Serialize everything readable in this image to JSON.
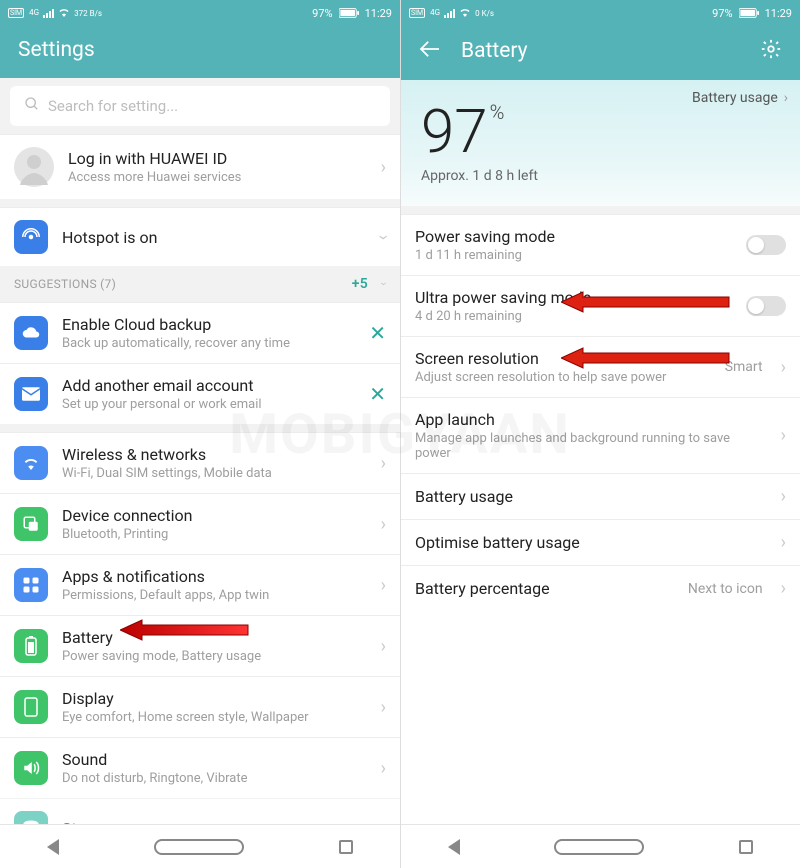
{
  "status": {
    "net1": "372 B/s",
    "net2": "0 K/s",
    "battery": "97%",
    "time": "11:29"
  },
  "left": {
    "title": "Settings",
    "searchPlaceholder": "Search for setting...",
    "login": {
      "title": "Log in with HUAWEI ID",
      "sub": "Access more Huawei services"
    },
    "hotspot": {
      "title": "Hotspot is on"
    },
    "suggestions": {
      "header": "SUGGESTIONS (7)",
      "more": "+5"
    },
    "sug1": {
      "title": "Enable Cloud backup",
      "sub": "Back up automatically, recover any time"
    },
    "sug2": {
      "title": "Add another email account",
      "sub": "Set up your personal or work email"
    },
    "items": {
      "wireless": {
        "title": "Wireless & networks",
        "sub": "Wi-Fi, Dual SIM settings, Mobile data"
      },
      "device": {
        "title": "Device connection",
        "sub": "Bluetooth, Printing"
      },
      "apps": {
        "title": "Apps & notifications",
        "sub": "Permissions, Default apps, App twin"
      },
      "battery": {
        "title": "Battery",
        "sub": "Power saving mode, Battery usage"
      },
      "display": {
        "title": "Display",
        "sub": "Eye comfort, Home screen style, Wallpaper"
      },
      "sound": {
        "title": "Sound",
        "sub": "Do not disturb, Ringtone, Vibrate"
      },
      "storage": {
        "title": "Storage"
      }
    }
  },
  "right": {
    "title": "Battery",
    "usageLink": "Battery usage",
    "pct": "97",
    "pctUnit": "%",
    "remaining": "Approx. 1 d 8 h left",
    "rows": {
      "psm": {
        "title": "Power saving mode",
        "sub": "1 d 11 h remaining"
      },
      "upsm": {
        "title": "Ultra power saving mode",
        "sub": "4 d 20 h remaining"
      },
      "res": {
        "title": "Screen resolution",
        "sub": "Adjust screen resolution to help save power",
        "val": "Smart"
      },
      "launch": {
        "title": "App launch",
        "sub": "Manage app launches and background running to save power"
      },
      "usage": {
        "title": "Battery usage"
      },
      "opt": {
        "title": "Optimise battery usage"
      },
      "pctrow": {
        "title": "Battery percentage",
        "val": "Next to icon"
      }
    }
  },
  "watermark": "MOBIGYAAN"
}
